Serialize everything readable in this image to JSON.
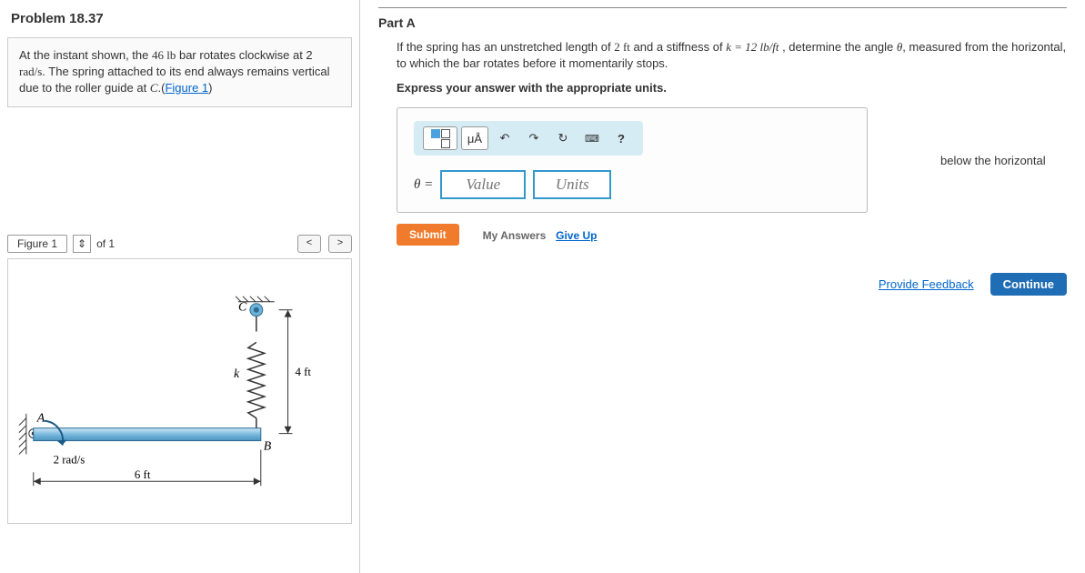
{
  "problem": {
    "title": "Problem 18.37",
    "statement_pre": "At the instant shown, the ",
    "weight": "46 lb",
    "statement_mid1": " bar rotates clockwise at 2 ",
    "rate_unit": "rad/s",
    "statement_mid2": ". The spring attached to its end always remains vertical due to the roller guide at ",
    "point": "C",
    "statement_post": ".(",
    "figure_link": "Figure 1",
    "statement_end": ")"
  },
  "figure": {
    "tab": "Figure 1",
    "selector_icon": "⇕",
    "of_text": "of 1",
    "prev": "<",
    "next": ">",
    "labels": {
      "C": "C",
      "B": "B",
      "A": "A",
      "k": "k",
      "h": "4 ft",
      "w": "6 ft",
      "omega": "2 rad/s"
    }
  },
  "partA": {
    "title": "Part A",
    "text_pre": "If the spring has an unstretched length of ",
    "len": "2 ft",
    "text_mid1": " and a stiffness of ",
    "k_eq": "k = 12 lb/ft",
    "text_mid2": " , determine the angle ",
    "theta": "θ",
    "text_post": ", measured from the horizontal, to which the bar rotates before it momentarily stops.",
    "instruction": "Express your answer with the appropriate units.",
    "answer": {
      "theta_eq": "θ =",
      "value_ph": "Value",
      "units_ph": "Units",
      "below": "below the horizontal"
    },
    "toolbar": {
      "templates": "templates",
      "units": "μÅ",
      "undo": "↶",
      "redo": "↷",
      "reset": "↻",
      "keyboard": "⌨",
      "help": "?"
    },
    "submit": "Submit",
    "my_answers": "My Answers",
    "give_up": "Give Up"
  },
  "footer": {
    "feedback": "Provide Feedback",
    "continue": "Continue"
  }
}
